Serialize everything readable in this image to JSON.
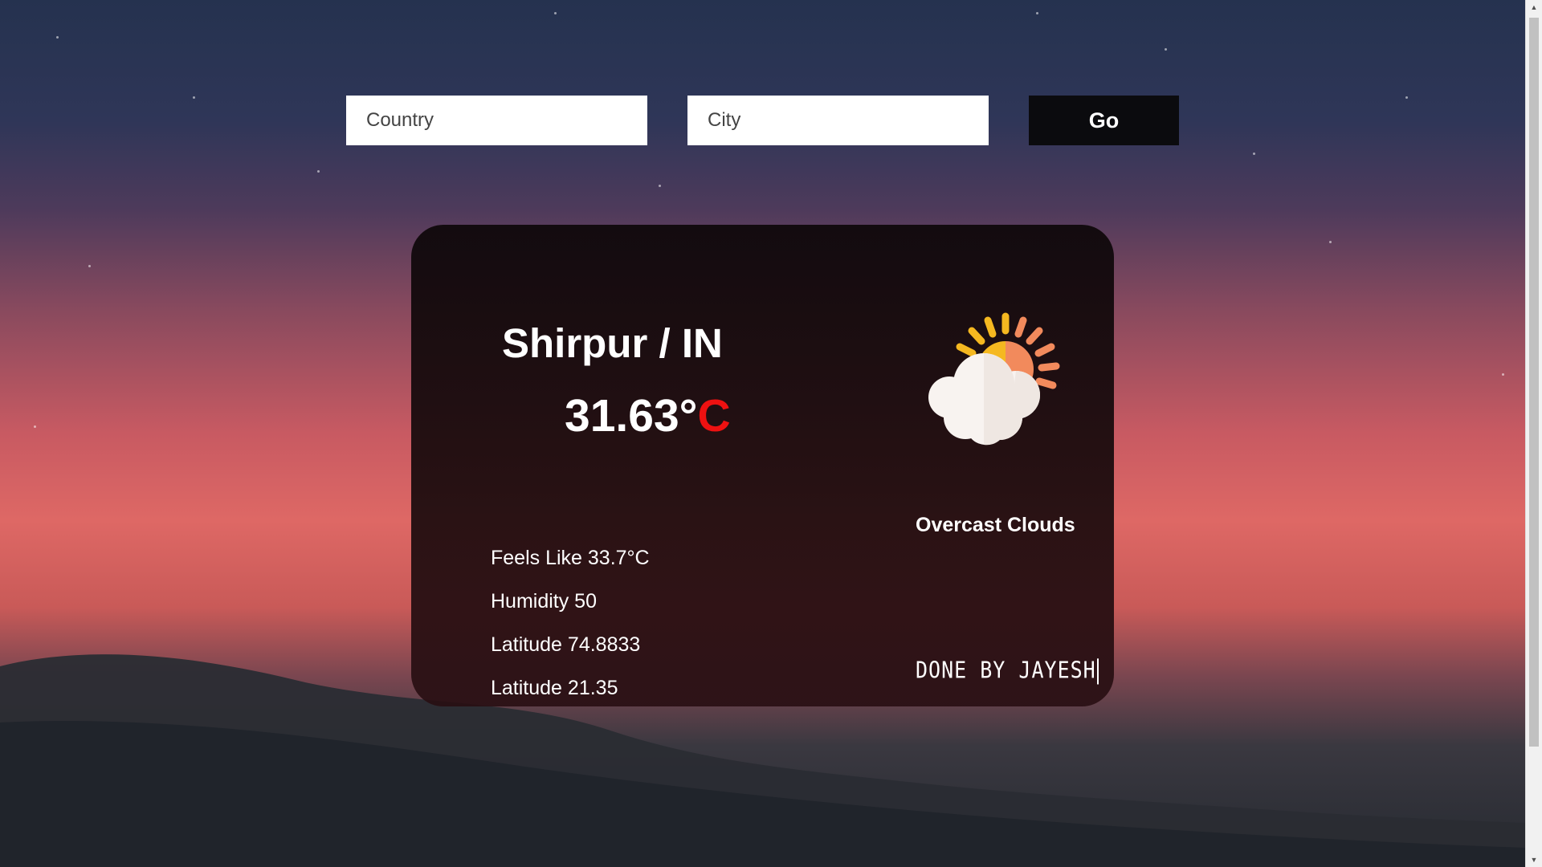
{
  "search": {
    "country_placeholder": "Country",
    "city_placeholder": "City",
    "go_label": "Go"
  },
  "weather": {
    "location": "Shirpur / IN",
    "temperature": "31.63°",
    "temperature_unit": "C",
    "condition": "Overcast Clouds",
    "icon": "sun-behind-cloud-icon",
    "details": {
      "feels_like": "Feels Like 33.7°C",
      "humidity": "Humidity 50",
      "latitude_1": "Latitude 74.8833",
      "latitude_2": "Latitude 21.35"
    }
  },
  "credit": "DONE BY JAYESH",
  "colors": {
    "button_bg": "#0b0b0e",
    "temperature_unit": "#ee1111",
    "card_bg": "#140a0d"
  }
}
